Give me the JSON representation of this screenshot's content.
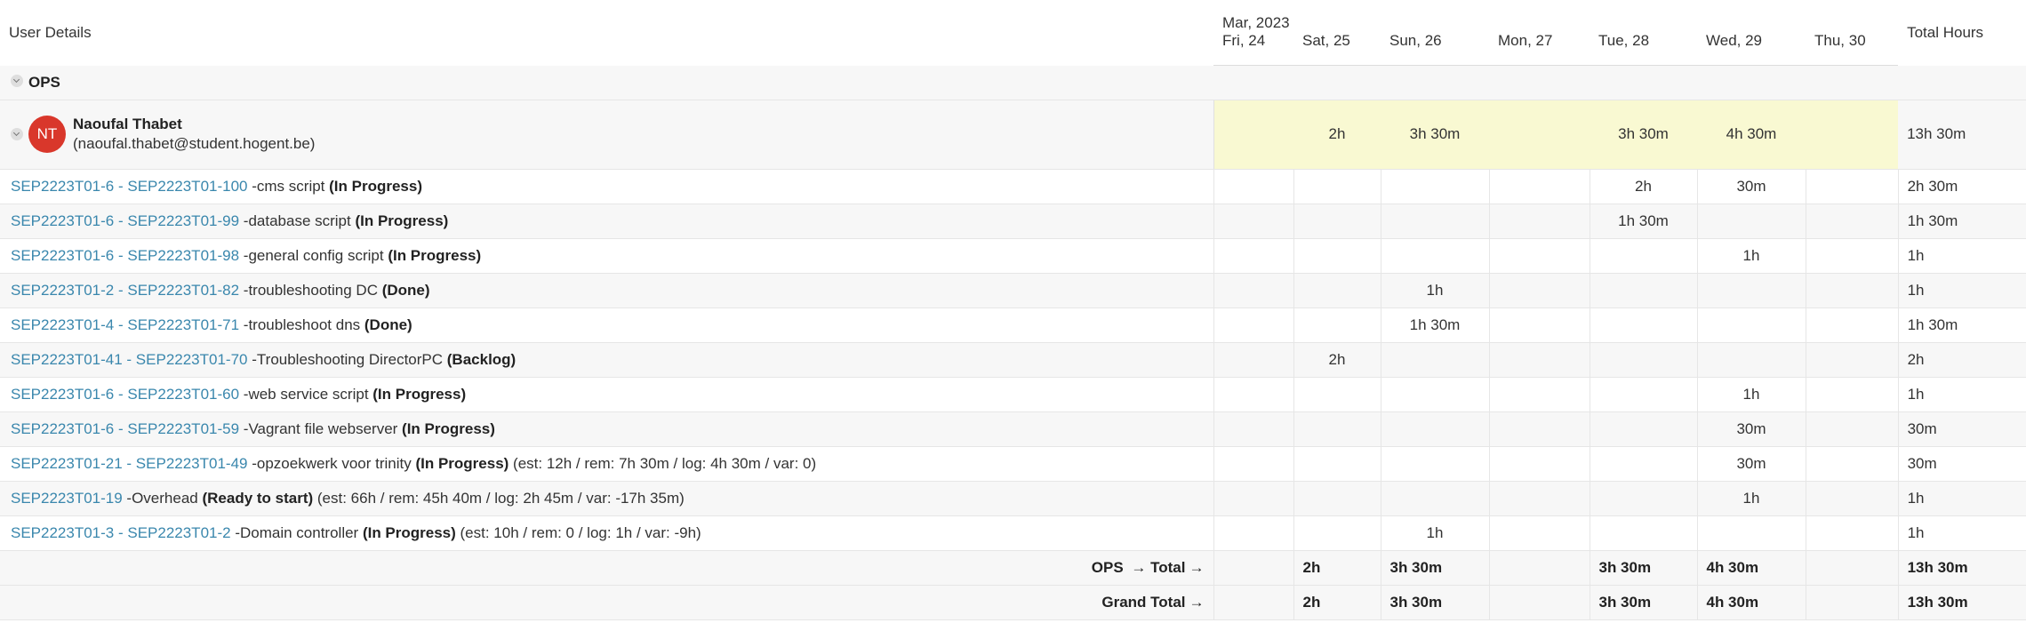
{
  "header": {
    "user_details": "User Details",
    "month": "Mar, 2023",
    "total_hours": "Total Hours",
    "days": [
      "Fri, 24",
      "Sat, 25",
      "Sun, 26",
      "Mon, 27",
      "Tue, 28",
      "Wed, 29",
      "Thu, 30"
    ]
  },
  "group": {
    "name": "OPS"
  },
  "user": {
    "initials": "NT",
    "avatar_color": "#d9372b",
    "name": "Naoufal Thabet",
    "email": "(naoufal.thabet@student.hogent.be)",
    "days": [
      "",
      "2h",
      "3h 30m",
      "",
      "3h 30m",
      "4h 30m",
      ""
    ],
    "total": "13h 30m"
  },
  "tasks": [
    {
      "key": "SEP2223T01-6 - SEP2223T01-100",
      "title": " -cms script ",
      "status": "(In Progress)",
      "extra": "",
      "days": [
        "",
        "",
        "",
        "",
        "2h",
        "30m",
        ""
      ],
      "total": "2h 30m"
    },
    {
      "key": "SEP2223T01-6 - SEP2223T01-99",
      "title": " -database script ",
      "status": "(In Progress)",
      "extra": "",
      "days": [
        "",
        "",
        "",
        "",
        "1h 30m",
        "",
        ""
      ],
      "total": "1h 30m"
    },
    {
      "key": "SEP2223T01-6 - SEP2223T01-98",
      "title": " -general config script ",
      "status": "(In Progress)",
      "extra": "",
      "days": [
        "",
        "",
        "",
        "",
        "",
        "1h",
        ""
      ],
      "total": "1h"
    },
    {
      "key": "SEP2223T01-2 - SEP2223T01-82",
      "title": " -troubleshooting DC ",
      "status": "(Done)",
      "extra": "",
      "days": [
        "",
        "",
        "1h",
        "",
        "",
        "",
        ""
      ],
      "total": "1h"
    },
    {
      "key": "SEP2223T01-4 - SEP2223T01-71",
      "title": " -troubleshoot dns ",
      "status": "(Done)",
      "extra": "",
      "days": [
        "",
        "",
        "1h 30m",
        "",
        "",
        "",
        ""
      ],
      "total": "1h 30m"
    },
    {
      "key": "SEP2223T01-41 - SEP2223T01-70",
      "title": " -Troubleshooting DirectorPC ",
      "status": "(Backlog)",
      "extra": "",
      "days": [
        "",
        "2h",
        "",
        "",
        "",
        "",
        ""
      ],
      "total": "2h"
    },
    {
      "key": "SEP2223T01-6 - SEP2223T01-60",
      "title": " -web service script ",
      "status": "(In Progress)",
      "extra": "",
      "days": [
        "",
        "",
        "",
        "",
        "",
        "1h",
        ""
      ],
      "total": "1h"
    },
    {
      "key": "SEP2223T01-6 - SEP2223T01-59",
      "title": " -Vagrant file webserver ",
      "status": "(In Progress)",
      "extra": "",
      "days": [
        "",
        "",
        "",
        "",
        "",
        "30m",
        ""
      ],
      "total": "30m"
    },
    {
      "key": "SEP2223T01-21 - SEP2223T01-49",
      "title": " -opzoekwerk voor trinity ",
      "status": "(In Progress)",
      "extra": " (est: 12h / rem: 7h 30m / log: 4h 30m / var: 0)",
      "days": [
        "",
        "",
        "",
        "",
        "",
        "30m",
        ""
      ],
      "total": "30m"
    },
    {
      "key": "SEP2223T01-19",
      "title": " -Overhead ",
      "status": "(Ready to start)",
      "extra": " (est: 66h / rem: 45h 40m / log: 2h 45m / var: -17h 35m)",
      "days": [
        "",
        "",
        "",
        "",
        "",
        "1h",
        ""
      ],
      "total": "1h"
    },
    {
      "key": "SEP2223T01-3 - SEP2223T01-2",
      "title": " -Domain controller ",
      "status": "(In Progress)",
      "extra": " (est: 10h / rem: 0 / log: 1h / var: -9h)",
      "days": [
        "",
        "",
        "1h",
        "",
        "",
        "",
        ""
      ],
      "total": "1h"
    }
  ],
  "ops_total": {
    "label": "OPS",
    "arrow": "→",
    "label2": "Total",
    "days": [
      "",
      "2h",
      "3h 30m",
      "",
      "3h 30m",
      "4h 30m",
      ""
    ],
    "total": "13h 30m"
  },
  "grand_total": {
    "label": "Grand Total",
    "days": [
      "",
      "2h",
      "3h 30m",
      "",
      "3h 30m",
      "4h 30m",
      ""
    ],
    "total": "13h 30m"
  },
  "icons": {
    "collapse": "chevron-down-icon",
    "arrow": "arrow-right-icon"
  }
}
